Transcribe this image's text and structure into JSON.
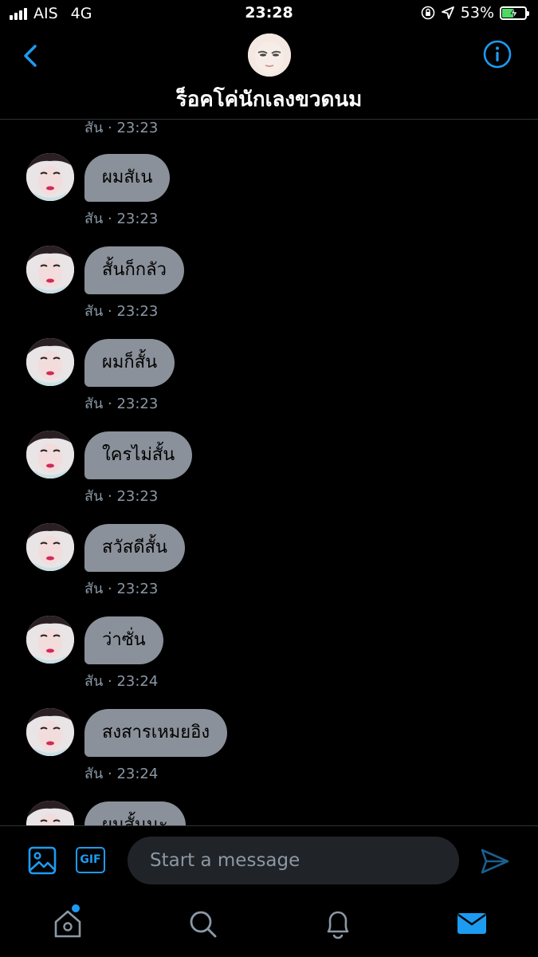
{
  "status_bar": {
    "carrier": "AIS",
    "network": "4G",
    "time": "23:28",
    "battery": "53%",
    "battery_level": 0.53
  },
  "header": {
    "name": "ร็อคโค่นักเลงขวดนม",
    "back_icon": "chevron-left-icon",
    "info_icon": "info-icon"
  },
  "conversation": {
    "top_time": "สัน · 23:23",
    "messages": [
      {
        "text": "ผมสัเน",
        "time": "สัน · 23:23"
      },
      {
        "text": "สั้นก็กลัว",
        "time": "สัน · 23:23"
      },
      {
        "text": "ผมก็สั้น",
        "time": "สัน · 23:23"
      },
      {
        "text": "ใครไม่สั้น",
        "time": "สัน · 23:23"
      },
      {
        "text": "สวัสดีสั้น",
        "time": "สัน · 23:23"
      },
      {
        "text": "ว่าซั่น",
        "time": "สัน · 23:24"
      },
      {
        "text": "สงสารเหมยอิง",
        "time": "สัน · 23:24"
      },
      {
        "text": "ผมสั้นนะ",
        "time": ""
      }
    ]
  },
  "composer": {
    "placeholder": "Start a message",
    "gif_label": "GIF"
  },
  "tabbar": {
    "items": [
      "home-icon",
      "search-icon",
      "bell-icon",
      "mail-icon"
    ],
    "active": "mail-icon"
  },
  "colors": {
    "accent": "#1d9bf0",
    "bubble": "#8b919a",
    "secondary_text": "#8b98a5"
  }
}
